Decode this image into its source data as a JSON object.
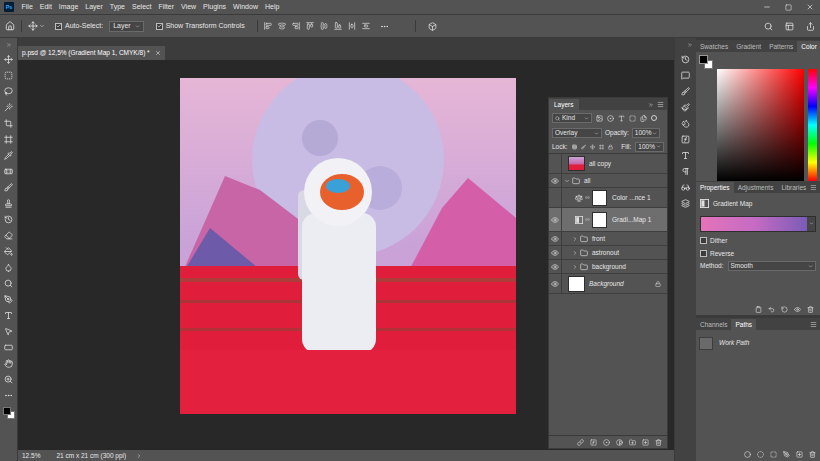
{
  "menu": {
    "logo": "Ps",
    "items": [
      "File",
      "Edit",
      "Image",
      "Layer",
      "Type",
      "Select",
      "Filter",
      "View",
      "Plugins",
      "Window",
      "Help"
    ]
  },
  "options_bar": {
    "auto_select": {
      "label": "Auto-Select:",
      "checked": true
    },
    "target": "Layer",
    "transform_controls": {
      "label": "Show Transform Controls",
      "checked": true
    }
  },
  "document": {
    "tab": "p.psd @ 12,5% (Gradient Map 1, CMYK/8) *",
    "selected": true
  },
  "status_bar": {
    "zoom": "12.5%",
    "info": "21 cm x 21 cm (300 ppi)"
  },
  "layers_panel": {
    "title": "Layers",
    "filter": "Kind",
    "blend_mode": "Overlay",
    "opacity_label": "Opacity:",
    "opacity": "100%",
    "lock_label": "Lock:",
    "fill_label": "Fill:",
    "fill": "100%",
    "layers": [
      {
        "name": "all copy",
        "kind": "image",
        "visible": false,
        "selected": false,
        "depth": 0
      },
      {
        "name": "all",
        "kind": "group",
        "visible": true,
        "selected": false,
        "expanded": true,
        "depth": 0
      },
      {
        "name": "Color ...nce 1",
        "kind": "balance",
        "visible": false,
        "selected": false,
        "depth": 1
      },
      {
        "name": "Gradi...Map 1",
        "kind": "gradientmap",
        "visible": true,
        "selected": true,
        "depth": 1
      },
      {
        "name": "front",
        "kind": "group",
        "visible": true,
        "selected": false,
        "expanded": false,
        "depth": 1
      },
      {
        "name": "astronout",
        "kind": "group",
        "visible": true,
        "selected": false,
        "expanded": false,
        "depth": 1
      },
      {
        "name": "background",
        "kind": "group",
        "visible": true,
        "selected": false,
        "expanded": false,
        "depth": 1
      },
      {
        "name": "Background",
        "kind": "background",
        "visible": true,
        "selected": false,
        "locked": true,
        "depth": 0
      }
    ]
  },
  "color_panel": {
    "tabs": [
      {
        "label": "Swatches",
        "selected": false
      },
      {
        "label": "Gradient",
        "selected": false
      },
      {
        "label": "Patterns",
        "selected": false
      },
      {
        "label": "Color",
        "selected": true
      }
    ]
  },
  "properties_panel": {
    "tabs": [
      {
        "label": "Properties",
        "selected": true
      },
      {
        "label": "Adjustments",
        "selected": false
      },
      {
        "label": "Libraries",
        "selected": false
      }
    ],
    "title": "Gradient Map",
    "options": [
      {
        "label": "Dither",
        "checked": false
      },
      {
        "label": "Reverse",
        "checked": false
      }
    ],
    "method_label": "Method:",
    "method": "Smooth"
  },
  "paths_panel": {
    "tabs": [
      {
        "label": "Channels",
        "selected": false
      },
      {
        "label": "Paths",
        "selected": true
      }
    ],
    "paths": [
      {
        "name": "Work Path",
        "selected": false
      }
    ]
  }
}
